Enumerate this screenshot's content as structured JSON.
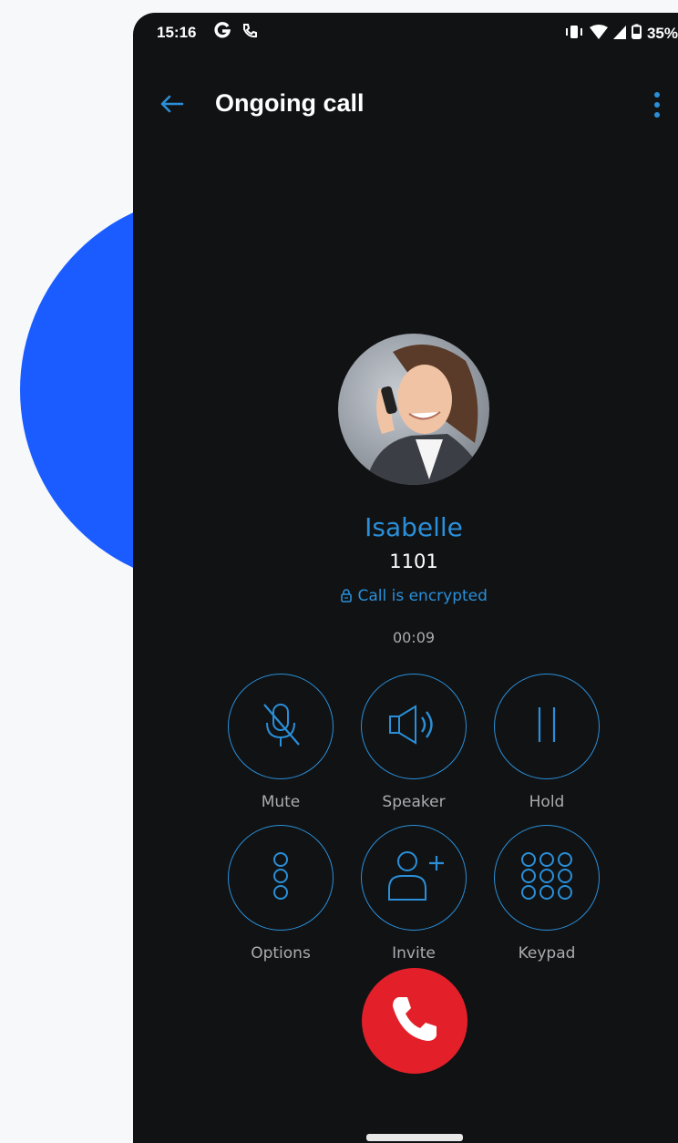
{
  "status": {
    "time": "15:16",
    "battery": "35%"
  },
  "header": {
    "title": "Ongoing call"
  },
  "caller": {
    "name": "Isabelle",
    "number": "1101",
    "encryption": "Call is encrypted",
    "duration": "00:09"
  },
  "controls": {
    "mute": "Mute",
    "speaker": "Speaker",
    "hold": "Hold",
    "options": "Options",
    "invite": "Invite",
    "keypad": "Keypad"
  },
  "colors": {
    "accent": "#2a8fd8",
    "hangup": "#e3202a",
    "background": "#111214",
    "decor": "#1a5cff"
  }
}
